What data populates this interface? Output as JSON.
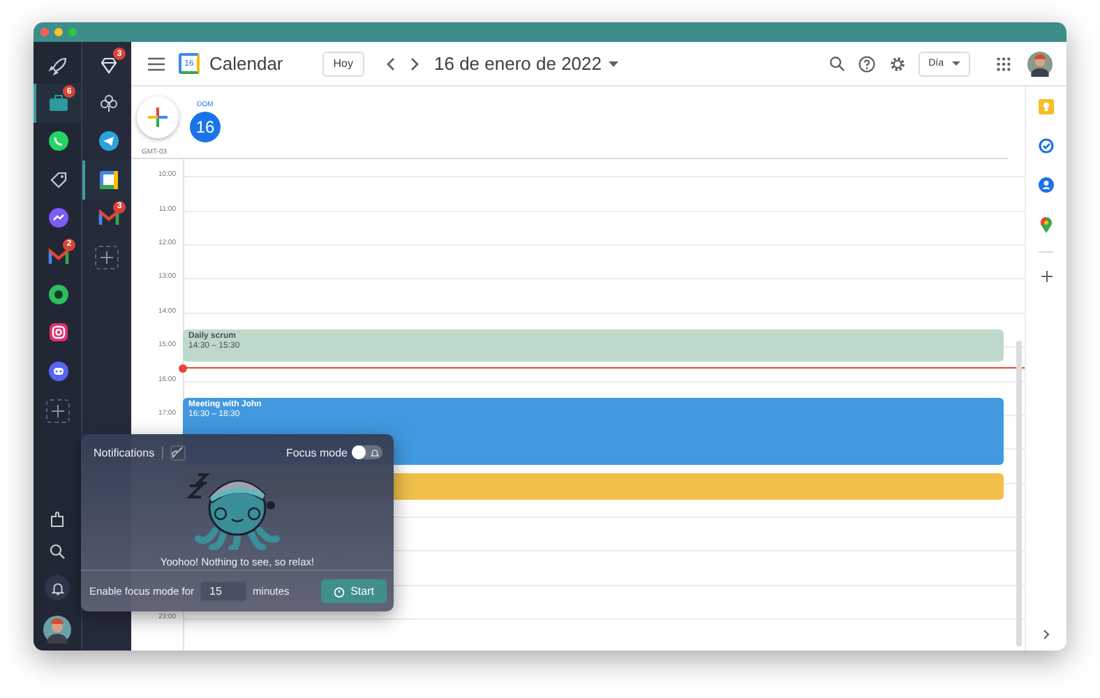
{
  "rails": [
    {
      "items": [
        {
          "kind": "rocket",
          "selected": false
        },
        {
          "kind": "briefcase",
          "selected": true,
          "badge": "6"
        },
        {
          "kind": "whatsapp",
          "selected": false
        },
        {
          "kind": "tag",
          "selected": false
        },
        {
          "kind": "messenger",
          "selected": false
        },
        {
          "kind": "gmail",
          "selected": false,
          "badge": "2"
        },
        {
          "kind": "evernote",
          "selected": false
        },
        {
          "kind": "instagram",
          "selected": false
        },
        {
          "kind": "discord",
          "selected": false
        }
      ]
    },
    {
      "items": [
        {
          "kind": "diamond",
          "selected": false,
          "badge": "3"
        },
        {
          "kind": "clover",
          "selected": false
        },
        {
          "kind": "telegram",
          "selected": false
        },
        {
          "kind": "calendar",
          "selected": true
        },
        {
          "kind": "gmail",
          "selected": false,
          "badge": "3"
        }
      ]
    }
  ],
  "header": {
    "app_name": "Calendar",
    "logo_text": "16",
    "today_button": "Hoy",
    "date": "16 de enero de 2022",
    "view": "Día"
  },
  "day": {
    "weekday": "DOM",
    "number": "16",
    "timezone": "GMT-03"
  },
  "hours": [
    "10:00",
    "11:00",
    "12:00",
    "13:00",
    "14:00",
    "15:00",
    "16:00",
    "17:00",
    "23:00"
  ],
  "events": [
    {
      "title": "Daily scrum",
      "time": "14:30 – 15:30",
      "color": "#bed9c9"
    },
    {
      "title": "Meeting with John",
      "time": "16:30 – 18:30",
      "color": "#4299e0"
    },
    {
      "color": "#f0bf4a"
    }
  ],
  "notifications": {
    "title": "Notifications",
    "focus_label": "Focus mode",
    "focus_on": false,
    "empty_message": "Yoohoo! Nothing to see, so relax!",
    "focus_prefix": "Enable focus mode for",
    "minutes_value": "15",
    "minutes_suffix": "minutes",
    "start_button": "Start"
  }
}
